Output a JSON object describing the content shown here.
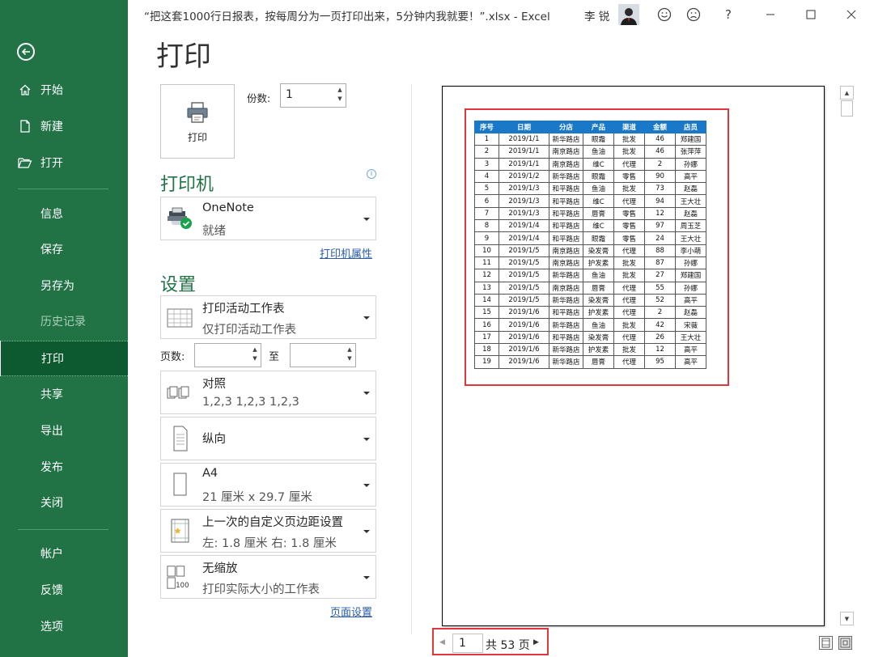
{
  "window": {
    "title": "“把这套1000行日报表，按每周分为一页打印出来，5分钟内我就要！”.xlsx  -  Excel",
    "user": "李 锐",
    "help": "?"
  },
  "sidebar": {
    "items": [
      {
        "label": "开始"
      },
      {
        "label": "新建"
      },
      {
        "label": "打开"
      },
      {
        "label": "信息"
      },
      {
        "label": "保存"
      },
      {
        "label": "另存为"
      },
      {
        "label": "历史记录"
      },
      {
        "label": "打印"
      },
      {
        "label": "共享"
      },
      {
        "label": "导出"
      },
      {
        "label": "发布"
      },
      {
        "label": "关闭"
      },
      {
        "label": "帐户"
      },
      {
        "label": "反馈"
      },
      {
        "label": "选项"
      }
    ],
    "active_item": "打印"
  },
  "page": {
    "title": "打印"
  },
  "print": {
    "button_label": "打印",
    "copies_label": "份数:",
    "copies_value": "1"
  },
  "printer": {
    "heading": "打印机",
    "name": "OneNote",
    "status": "就绪",
    "properties_link": "打印机属性"
  },
  "settings": {
    "heading": "设置",
    "scope": {
      "title": "打印活动工作表",
      "subtitle": "仅打印活动工作表"
    },
    "pages_label": "页数:",
    "pages_from": "",
    "to_label": "至",
    "pages_to": "",
    "collate": {
      "title": "对照",
      "subtitle": "1,2,3    1,2,3    1,2,3"
    },
    "orientation": {
      "title": "纵向"
    },
    "paper": {
      "title": "A4",
      "subtitle": "21 厘米 x 29.7 厘米"
    },
    "margins": {
      "title": "上一次的自定义页边距设置",
      "subtitle": "左:  1.8 厘米     右:  1.8 厘米"
    },
    "scaling": {
      "title": "无缩放",
      "subtitle": "打印实际大小的工作表",
      "icon_text": "100"
    },
    "page_setup_link": "页面设置"
  },
  "preview": {
    "headers": [
      "序号",
      "日期",
      "分店",
      "产品",
      "渠道",
      "金额",
      "店员"
    ],
    "rows": [
      [
        "1",
        "2019/1/1",
        "新华路店",
        "眼霜",
        "批发",
        "46",
        "郑建国"
      ],
      [
        "2",
        "2019/1/1",
        "南京路店",
        "鱼油",
        "批发",
        "46",
        "张萍萍"
      ],
      [
        "3",
        "2019/1/1",
        "南京路店",
        "维C",
        "代理",
        "2",
        "孙娜"
      ],
      [
        "4",
        "2019/1/2",
        "新华路店",
        "眼霜",
        "零售",
        "90",
        "高平"
      ],
      [
        "5",
        "2019/1/3",
        "和平路店",
        "鱼油",
        "批发",
        "73",
        "赵磊"
      ],
      [
        "6",
        "2019/1/3",
        "和平路店",
        "维C",
        "代理",
        "94",
        "王大壮"
      ],
      [
        "7",
        "2019/1/3",
        "和平路店",
        "唇膏",
        "零售",
        "12",
        "赵磊"
      ],
      [
        "8",
        "2019/1/4",
        "和平路店",
        "维C",
        "零售",
        "97",
        "周玉芝"
      ],
      [
        "9",
        "2019/1/4",
        "和平路店",
        "眼霜",
        "零售",
        "24",
        "王大壮"
      ],
      [
        "10",
        "2019/1/5",
        "南京路店",
        "染发膏",
        "代理",
        "88",
        "李小萌"
      ],
      [
        "11",
        "2019/1/5",
        "南京路店",
        "护发素",
        "批发",
        "87",
        "孙娜"
      ],
      [
        "12",
        "2019/1/5",
        "新华路店",
        "鱼油",
        "批发",
        "27",
        "郑建国"
      ],
      [
        "13",
        "2019/1/5",
        "南京路店",
        "唇膏",
        "代理",
        "55",
        "孙娜"
      ],
      [
        "14",
        "2019/1/5",
        "新华路店",
        "染发膏",
        "代理",
        "52",
        "高平"
      ],
      [
        "15",
        "2019/1/6",
        "和平路店",
        "护发素",
        "代理",
        "2",
        "赵磊"
      ],
      [
        "16",
        "2019/1/6",
        "新华路店",
        "鱼油",
        "批发",
        "42",
        "宋薇"
      ],
      [
        "17",
        "2019/1/6",
        "和平路店",
        "染发膏",
        "代理",
        "26",
        "王大壮"
      ],
      [
        "18",
        "2019/1/6",
        "新华路店",
        "护发素",
        "批发",
        "12",
        "高平"
      ],
      [
        "19",
        "2019/1/6",
        "新华路店",
        "唇膏",
        "代理",
        "95",
        "高平"
      ]
    ]
  },
  "navigator": {
    "current_page": "1",
    "total_label": "共 53 页"
  },
  "colors": {
    "sidebar": "#217346",
    "sidebar_active": "#0e5a30",
    "accent_heading": "#217346",
    "table_header": "#1a78c8",
    "highlight": "#e0373c",
    "link": "#2a5ca8"
  }
}
